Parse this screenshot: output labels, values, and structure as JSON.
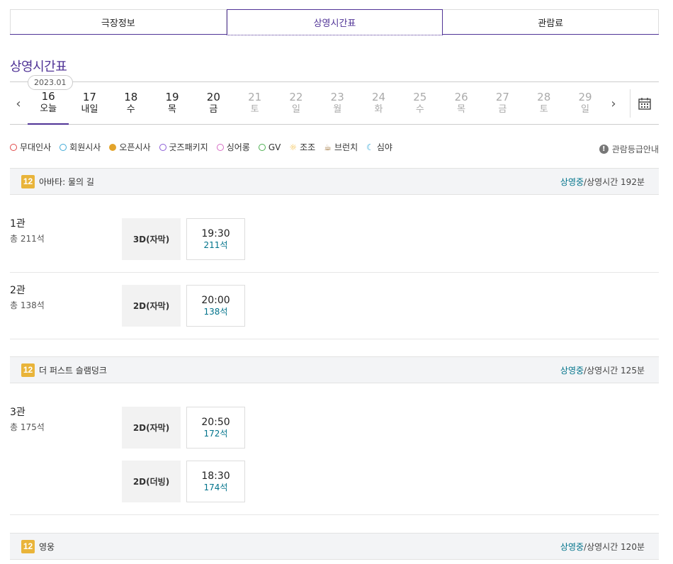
{
  "tabs": [
    {
      "label": "극장정보"
    },
    {
      "label": "상영시간표"
    },
    {
      "label": "관람료"
    }
  ],
  "section_title": "상영시간표",
  "datebar": {
    "year_month": "2023.01",
    "days": [
      {
        "num": "16",
        "wd": "오늘"
      },
      {
        "num": "17",
        "wd": "내일"
      },
      {
        "num": "18",
        "wd": "수"
      },
      {
        "num": "19",
        "wd": "목"
      },
      {
        "num": "20",
        "wd": "금"
      },
      {
        "num": "21",
        "wd": "토"
      },
      {
        "num": "22",
        "wd": "일"
      },
      {
        "num": "23",
        "wd": "월"
      },
      {
        "num": "24",
        "wd": "화"
      },
      {
        "num": "25",
        "wd": "수"
      },
      {
        "num": "26",
        "wd": "목"
      },
      {
        "num": "27",
        "wd": "금"
      },
      {
        "num": "28",
        "wd": "토"
      },
      {
        "num": "29",
        "wd": "일"
      }
    ],
    "prev_icon": "chevron-left-icon",
    "next_icon": "chevron-right-icon",
    "calendar_icon": "calendar-icon"
  },
  "legend": [
    {
      "label": "무대인사",
      "color": "#e04848"
    },
    {
      "label": "회원시사",
      "color": "#3fa9d6"
    },
    {
      "label": "오픈시사",
      "color": "#e3a42b"
    },
    {
      "label": "굿즈패키지",
      "color": "#8a5bd6"
    },
    {
      "label": "싱어롱",
      "color": "#d66bc4"
    },
    {
      "label": "GV",
      "color": "#4caf50"
    },
    {
      "label": "조조",
      "color": "#f2b632"
    },
    {
      "label": "브런치",
      "color": "#a0743c"
    },
    {
      "label": "심야",
      "color": "#2ba4d6"
    }
  ],
  "rating_guide": "관람등급안내",
  "movies": [
    {
      "age": "12",
      "title": "아바타: 물의 길",
      "status": "상영중",
      "runtime": "/상영시간 192분",
      "halls": [
        {
          "name": "1관",
          "seats": "총 211석",
          "shows": [
            {
              "type": "3D(자막)",
              "time": "19:30",
              "remain": "211석"
            }
          ]
        },
        {
          "name": "2관",
          "seats": "총 138석",
          "shows": [
            {
              "type": "2D(자막)",
              "time": "20:00",
              "remain": "138석"
            }
          ]
        }
      ]
    },
    {
      "age": "12",
      "title": "더 퍼스트 슬램덩크",
      "status": "상영중",
      "runtime": "/상영시간 125분",
      "halls": [
        {
          "name": "3관",
          "seats": "총 175석",
          "shows": [
            {
              "type": "2D(자막)",
              "time": "20:50",
              "remain": "172석"
            },
            {
              "type": "2D(더빙)",
              "time": "18:30",
              "remain": "174석"
            }
          ]
        }
      ]
    },
    {
      "age": "12",
      "title": "영웅",
      "status": "상영중",
      "runtime": "/상영시간 120분",
      "halls": []
    }
  ]
}
